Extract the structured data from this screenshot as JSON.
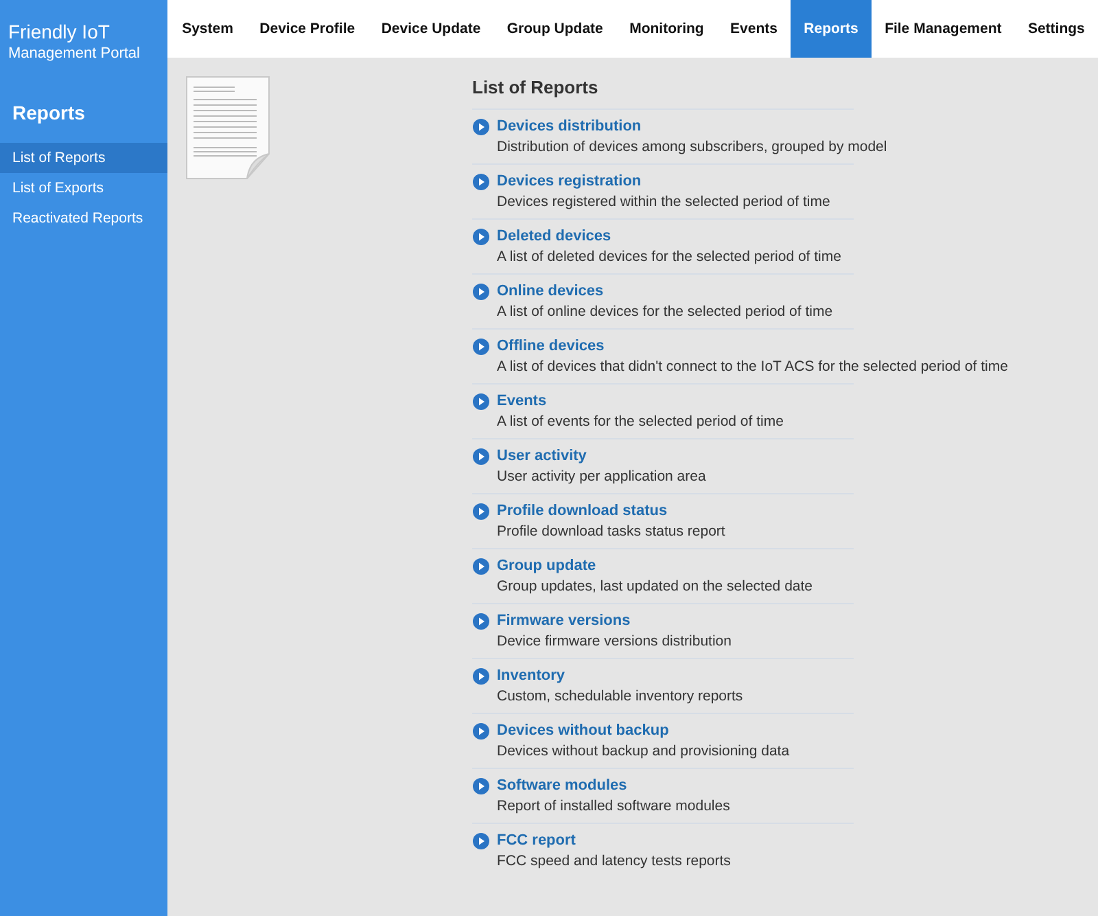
{
  "brand": {
    "title": "Friendly IoT",
    "subtitle": "Management Portal"
  },
  "nav": [
    {
      "label": "System",
      "selected": false
    },
    {
      "label": "Device Profile",
      "selected": false
    },
    {
      "label": "Device Update",
      "selected": false
    },
    {
      "label": "Group Update",
      "selected": false
    },
    {
      "label": "Monitoring",
      "selected": false
    },
    {
      "label": "Events",
      "selected": false
    },
    {
      "label": "Reports",
      "selected": true
    },
    {
      "label": "File Management",
      "selected": false
    },
    {
      "label": "Settings",
      "selected": false
    }
  ],
  "sidebar": {
    "heading": "Reports",
    "items": [
      {
        "label": "List of Reports",
        "selected": true
      },
      {
        "label": "List of Exports",
        "selected": false
      },
      {
        "label": "Reactivated Reports",
        "selected": false
      }
    ]
  },
  "content": {
    "title": "List of Reports",
    "reports": [
      {
        "name": "Devices distribution",
        "description": "Distribution of devices among subscribers, grouped by model"
      },
      {
        "name": "Devices registration",
        "description": "Devices registered within the selected period of time"
      },
      {
        "name": "Deleted devices",
        "description": "A list of deleted devices for the selected period of time"
      },
      {
        "name": "Online devices",
        "description": "A list of online devices for the selected period of time"
      },
      {
        "name": "Offline devices",
        "description": "A list of devices that didn't connect to the IoT ACS for the selected period of time"
      },
      {
        "name": "Events",
        "description": "A list of events for the selected period of time"
      },
      {
        "name": "User activity",
        "description": "User activity per application area"
      },
      {
        "name": "Profile download status",
        "description": "Profile download tasks status report"
      },
      {
        "name": "Group update",
        "description": "Group updates, last updated on the selected date"
      },
      {
        "name": "Firmware versions",
        "description": "Device firmware versions distribution"
      },
      {
        "name": "Inventory",
        "description": "Custom, schedulable inventory reports"
      },
      {
        "name": "Devices without backup",
        "description": "Devices without backup and provisioning data"
      },
      {
        "name": "Software modules",
        "description": "Report of installed software modules"
      },
      {
        "name": "FCC report",
        "description": "FCC speed and latency tests reports"
      }
    ]
  }
}
